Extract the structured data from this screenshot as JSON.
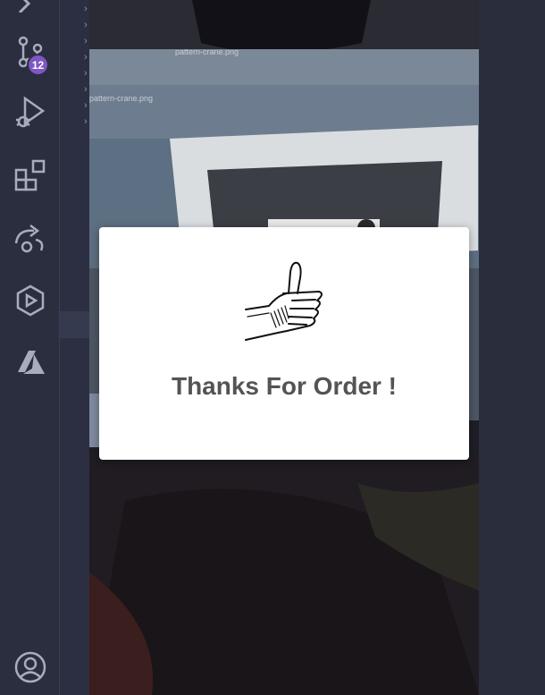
{
  "activity_bar": {
    "source_control_badge": "12"
  },
  "background_photo": {
    "file_label_top": "pattern-crane.png",
    "file_label_left": "pattern-crane.png"
  },
  "modal": {
    "message": "Thanks For Order !"
  },
  "colors": {
    "activity_bar_bg": "#2b2e3f",
    "badge": "#7e57c2",
    "icon": "#a9acbd",
    "modal_bg": "#ffffff",
    "modal_text": "#545454"
  }
}
